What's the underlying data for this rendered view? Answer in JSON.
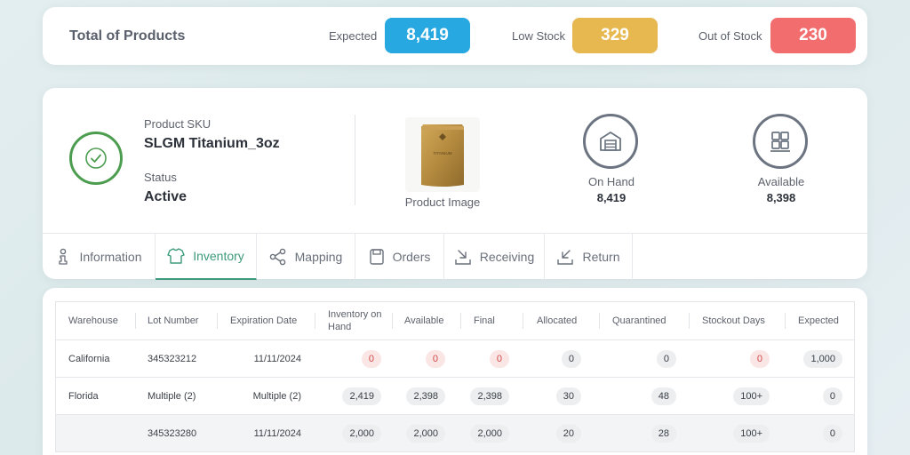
{
  "summary": {
    "title": "Total of Products",
    "expected_label": "Expected",
    "expected_value": "8,419",
    "low_label": "Low Stock",
    "low_value": "329",
    "out_label": "Out of Stock",
    "out_value": "230",
    "colors": {
      "expected": "#27a8e0",
      "low": "#e6b84f",
      "out": "#f26d6d"
    }
  },
  "product": {
    "sku_label": "Product SKU",
    "sku_value": "SLGM Titanium_3oz",
    "status_label": "Status",
    "status_value": "Active",
    "image_caption": "Product Image",
    "image_text": "TITANIUM",
    "on_hand_label": "On Hand",
    "on_hand_value": "8,419",
    "available_label": "Available",
    "available_value": "8,398"
  },
  "tabs": [
    {
      "label": "Information",
      "icon": "person-info-icon"
    },
    {
      "label": "Inventory",
      "icon": "shirt-icon"
    },
    {
      "label": "Mapping",
      "icon": "mapping-icon"
    },
    {
      "label": "Orders",
      "icon": "orders-icon"
    },
    {
      "label": "Receiving",
      "icon": "receiving-icon"
    },
    {
      "label": "Return",
      "icon": "return-icon"
    }
  ],
  "active_tab": "Inventory",
  "table": {
    "headers": [
      "Warehouse",
      "Lot Number",
      "Expiration Date",
      "Inventory on Hand",
      "Available",
      "Final",
      "Allocated",
      "Quarantined",
      "Stockout Days",
      "Expected"
    ],
    "rows": [
      {
        "warehouse": "California",
        "lot": "345323212",
        "expiration": "11/11/2024",
        "on_hand": "0",
        "available": "0",
        "final": "0",
        "allocated": "0",
        "quarantined": "0",
        "stockout": "0",
        "expected": "1,000"
      },
      {
        "warehouse": "Florida",
        "lot": "Multiple (2)",
        "expiration": "Multiple (2)",
        "on_hand": "2,419",
        "available": "2,398",
        "final": "2,398",
        "allocated": "30",
        "quarantined": "48",
        "stockout": "100+",
        "expected": "0"
      },
      {
        "warehouse": "",
        "lot": "345323280",
        "expiration": "11/11/2024",
        "on_hand": "2,000",
        "available": "2,000",
        "final": "2,000",
        "allocated": "20",
        "quarantined": "28",
        "stockout": "100+",
        "expected": "0"
      }
    ]
  }
}
